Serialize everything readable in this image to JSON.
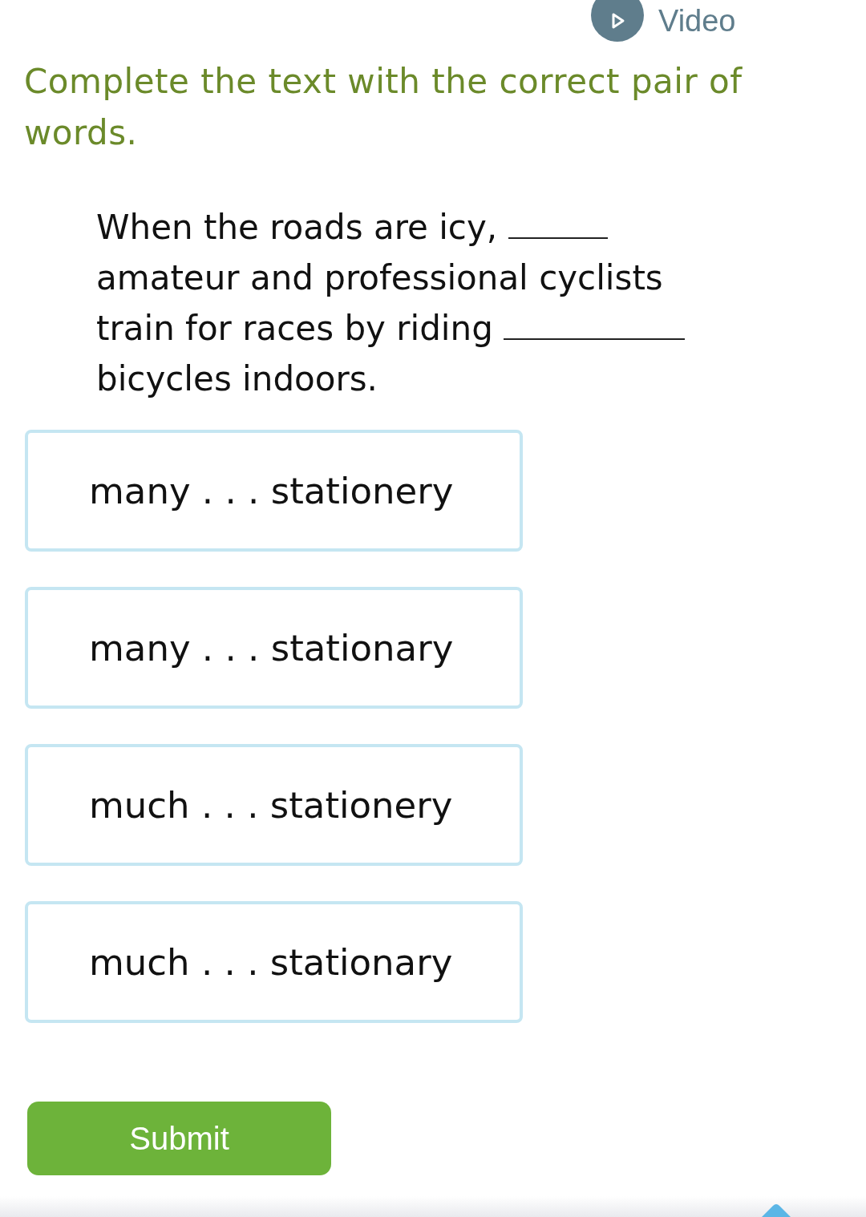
{
  "video_button": {
    "label": "Video"
  },
  "instruction": "Complete the text with the correct pair of words.",
  "passage": [
    {
      "kind": "text",
      "text": "When the roads are icy,"
    },
    {
      "kind": "blank"
    },
    {
      "kind": "text",
      "text": "amateur and professional cyclists train for races by riding"
    },
    {
      "kind": "longblank"
    },
    {
      "kind": "text",
      "text": "bicycles indoors."
    }
  ],
  "options": [
    {
      "label": "many . . . stationery",
      "selected": false
    },
    {
      "label": "many . . . stationary",
      "selected": false
    },
    {
      "label": "much . . . stationery",
      "selected": false
    },
    {
      "label": "much . . . stationary",
      "selected": false
    }
  ],
  "submit_button": {
    "label": "Submit"
  }
}
